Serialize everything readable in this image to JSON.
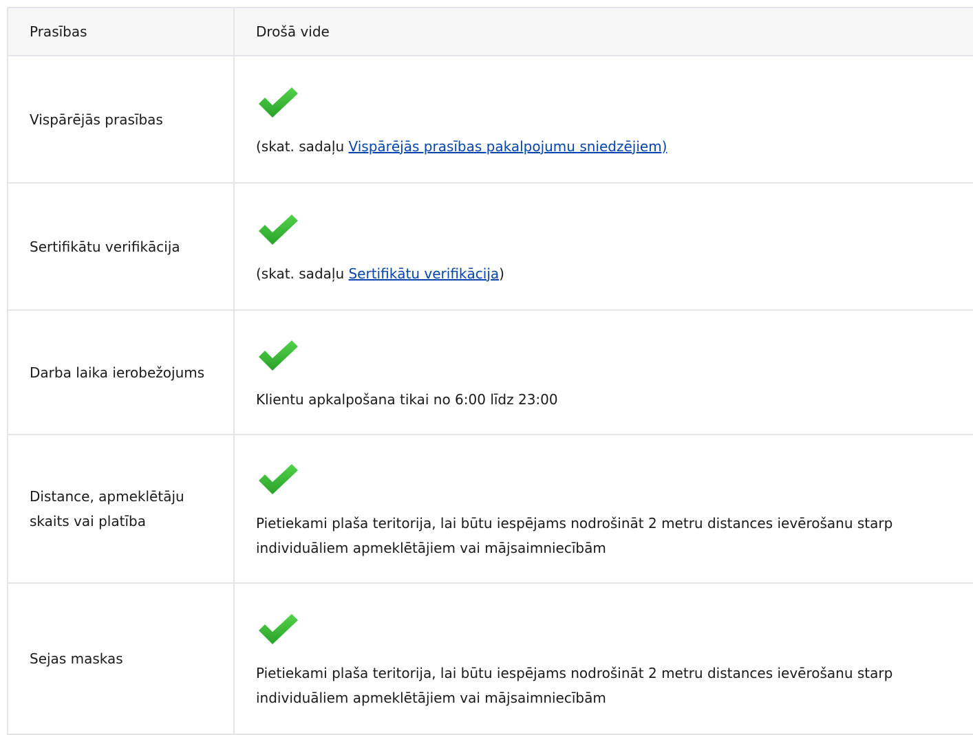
{
  "table": {
    "headers": [
      "Prasības",
      "Drošā vide"
    ],
    "rows": [
      {
        "requirement": "Vispārējās prasības",
        "prefix": "(skat. sadaļu ",
        "link": "Vispārējās prasības pakalpojumu sniedzējiem)",
        "suffix": ""
      },
      {
        "requirement": "Sertifikātu verifikācija",
        "prefix": "(skat. sadaļu ",
        "link": "Sertifikātu verifikācija",
        "suffix": ")"
      },
      {
        "requirement": "Darba laika ierobežojums",
        "note": "Klientu apkalpošana tikai no 6:00 līdz 23:00"
      },
      {
        "requirement": "Distance, apmeklētāju skaits vai platība",
        "note": "Pietiekami plaša teritorija, lai būtu iespējams nodrošināt 2 metru distances ievērošanu starp individuāliem apmeklētājiem vai mājsaimniecībām"
      },
      {
        "requirement": "Sejas maskas",
        "note": "Pietiekami plaša teritorija, lai būtu iespējams nodrošināt 2 metru distances ievērošanu starp individuāliem apmeklētājiem vai mājsaimniecībām"
      }
    ]
  },
  "icons": {
    "check": "check-icon"
  },
  "colors": {
    "check_green": "#3dbb34",
    "link": "#0645ad",
    "border": "#e3e5e8",
    "header_bg": "#f7f7f8"
  }
}
